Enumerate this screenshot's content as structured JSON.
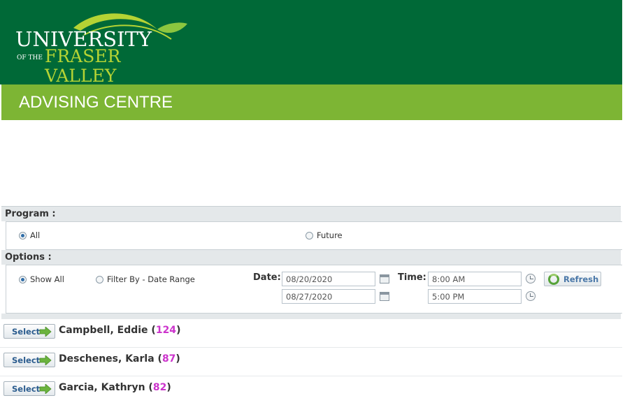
{
  "header": {
    "logo_university": "UNIVERSITY",
    "logo_of_the": "OF THE",
    "logo_fraser_valley": "FRASER VALLEY",
    "brand_dark": "#006937",
    "brand_light": "#7db534"
  },
  "banner": {
    "title": "ADVISING CENTRE"
  },
  "program": {
    "label": "Program :",
    "options": [
      {
        "label": "All",
        "selected": true
      },
      {
        "label": "Future",
        "selected": false
      }
    ]
  },
  "options": {
    "label": "Options :",
    "filters": [
      {
        "label": "Show All",
        "selected": true
      },
      {
        "label": "Filter By - Date Range",
        "selected": false
      }
    ],
    "date_label": "Date:",
    "date_from": "08/20/2020",
    "date_to": "08/27/2020",
    "time_label": "Time:",
    "time_from": "8:00 AM",
    "time_to": "5:00 PM",
    "refresh_label": "Refresh"
  },
  "advisors": [
    {
      "select_label": "Select",
      "name": "Campbell, Eddie",
      "count": "124"
    },
    {
      "select_label": "Select",
      "name": "Deschenes, Karla",
      "count": "87"
    },
    {
      "select_label": "Select",
      "name": "Garcia, Kathryn",
      "count": "82"
    }
  ],
  "icons": {
    "logo": "leaf-logo-icon",
    "calendar": "calendar-icon",
    "clock": "clock-icon",
    "refresh": "refresh-icon",
    "arrow": "arrow-right-icon"
  }
}
